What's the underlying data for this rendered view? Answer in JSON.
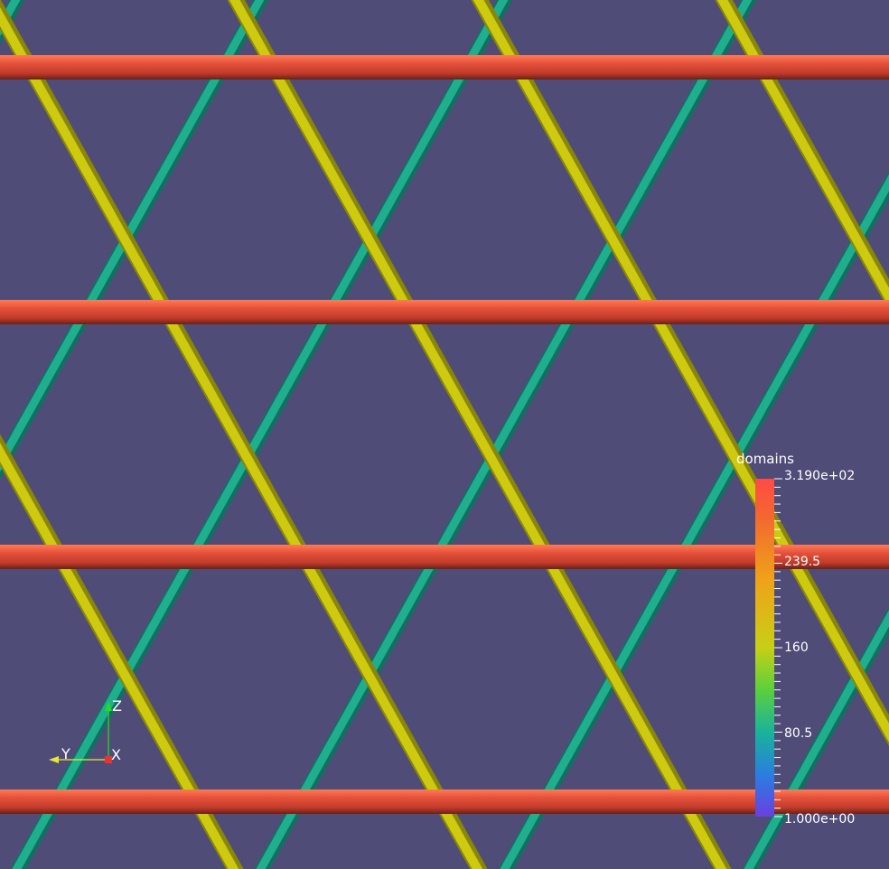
{
  "colorbar": {
    "title": "domains",
    "labels": [
      "3.190e+02",
      "239.5",
      "160",
      "80.5",
      "1.000e+00"
    ],
    "range": [
      1.0,
      319.0
    ]
  },
  "orientation_axes": {
    "z": "Z",
    "y": "Y",
    "x": "X"
  },
  "colors": {
    "background": "#4f4d77",
    "tube_high": "#e4503a",
    "tube_mid": "#c6c40c",
    "tube_low": "#199a80",
    "axis_z": "#22dd22",
    "axis_y": "#e8e833",
    "axis_x": "#e83333"
  }
}
